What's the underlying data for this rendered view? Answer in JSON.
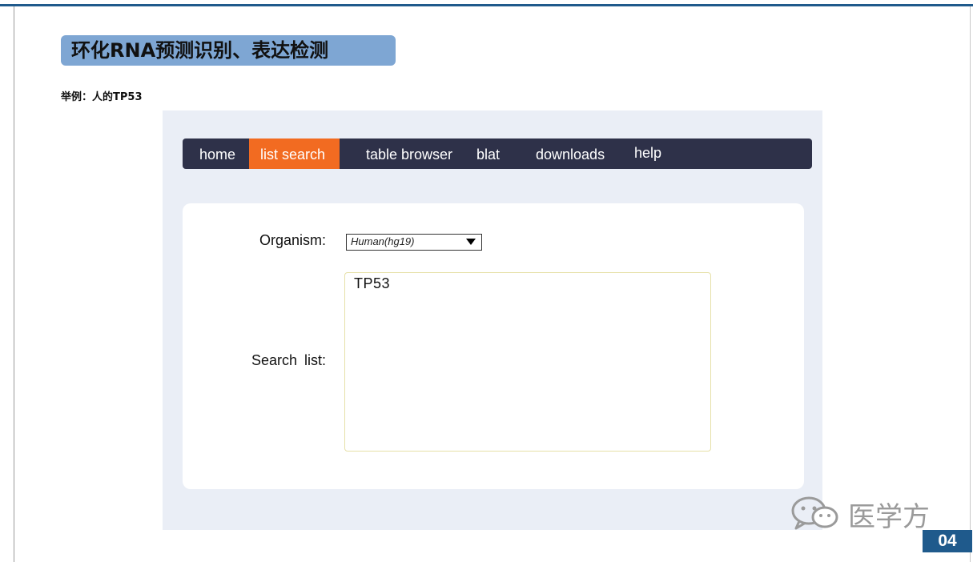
{
  "slide": {
    "title": "环化RNA预测识别、表达检测",
    "example_label": "举例：人的TP53",
    "page_number": "04",
    "watermark": "医学方"
  },
  "nav": {
    "items": [
      {
        "label": "home"
      },
      {
        "label": "list search",
        "active": true
      },
      {
        "label": "table browser"
      },
      {
        "label": "blat"
      },
      {
        "label": "downloads"
      },
      {
        "label": "help"
      }
    ]
  },
  "form": {
    "organism_label": "Organism:",
    "organism_value": "Human(hg19)",
    "search_list_label": "Search list:",
    "search_list_value": "TP53"
  },
  "colors": {
    "nav_bg": "#2e3149",
    "nav_active": "#f26b21",
    "title_bg": "#7ea6d3",
    "panel_bg": "#eaeef6",
    "accent_blue": "#1f5a8c"
  },
  "icons": {
    "dropdown": "chevron-down-icon",
    "watermark": "wechat-icon"
  }
}
